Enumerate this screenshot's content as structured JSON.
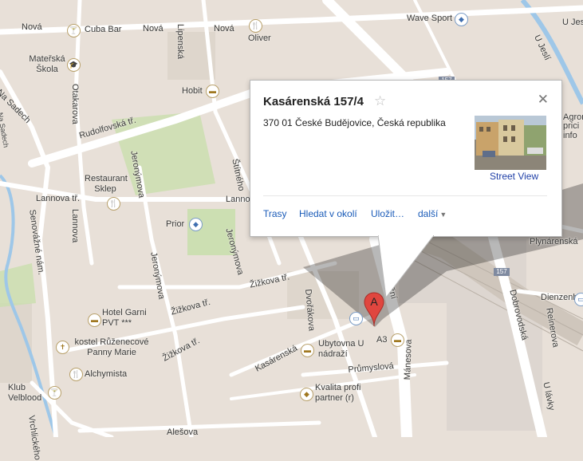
{
  "info_window": {
    "title": "Kasárenská 157/4",
    "address": "370 01 České Budějovice, Česká republika",
    "street_view_label": "Street View",
    "actions": [
      "Trasy",
      "Hledat v okolí",
      "Uložit…",
      "další"
    ],
    "star_icon": "star-outline-icon",
    "close_icon": "close-icon"
  },
  "marker": {
    "label": "A"
  },
  "street_labels": [
    "Nová",
    "Nová",
    "Lipenská",
    "Na Sadech",
    "Rudolfovská tř.",
    "Otakarova",
    "Lannova tř.",
    "Lannova",
    "Lannova",
    "Jeronýmova",
    "Jeronýmova",
    "Jeronýmova",
    "Žižkova tř.",
    "Žižkova tř.",
    "Žižkova tř.",
    "Senovážné nám.",
    "Dvořákova",
    "Kasárenská",
    "Průmyslová",
    "Mánesova",
    "Nádražní",
    "Dobrovodská",
    "Plynárenská",
    "Dienzenhoferova",
    "Reinerova",
    "U Jeslí",
    "U Jeslí",
    "U lávky",
    "Alešova",
    "Vrchlického",
    "Štítného",
    "Nová",
    "Na Sadech"
  ],
  "place_labels": [
    "Cuba Bar",
    "Oliver",
    "Wave Sport",
    "Mateřská Škola",
    "Hobit",
    "Restaurant Sklep",
    "Prior",
    "Hotel Garni PVT ***",
    "kostel Růženecové Panny Marie",
    "Alchymista",
    "Klub Velblood",
    "Ubytovna U nádraží",
    "A3",
    "Kvalita profi partner (r)",
    "Agron",
    "prici",
    "info"
  ],
  "road_shields": [
    "157",
    "157"
  ],
  "colors": {
    "map_bg": "#e8e0d8",
    "road": "#ffffff",
    "river": "#9ec7e8",
    "park": "#c9dfae",
    "link": "#1a5bb8",
    "marker": "#e0463f"
  }
}
